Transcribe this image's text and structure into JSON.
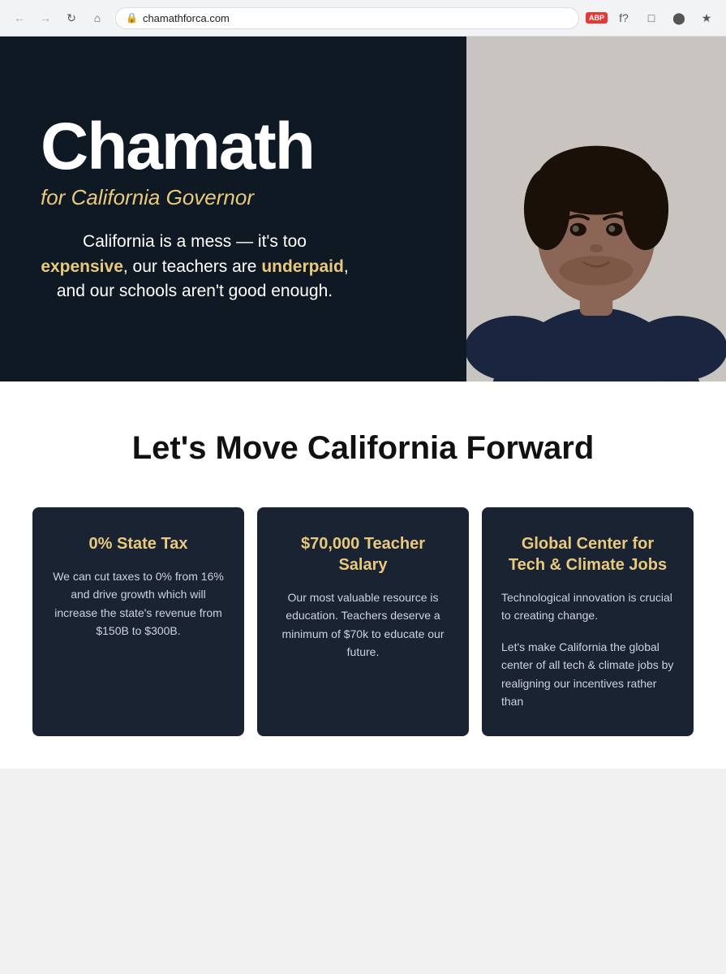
{
  "browser": {
    "url": "chamathforca.com",
    "back_label": "←",
    "forward_label": "→",
    "refresh_label": "↻",
    "home_label": "⌂",
    "abp_label": "ABP",
    "extensions": [
      "f?",
      "◻",
      "●",
      "⚙"
    ]
  },
  "hero": {
    "title": "Chamath",
    "subtitle": "for California Governor",
    "description_plain": "California is a mess — it's too ",
    "description_expensive": "expensive",
    "description_mid": ", our teachers are ",
    "description_underpaid": "underpaid",
    "description_end": ", and our schools aren't good enough."
  },
  "main": {
    "section_title": "Let's Move California Forward",
    "cards": [
      {
        "title": "0% State Tax",
        "body": "We can cut taxes to 0% from 16% and drive growth which will increase the state's revenue from $150B to $300B."
      },
      {
        "title": "$70,000 Teacher Salary",
        "body": "Our most valuable resource is education. Teachers deserve a minimum of $70k to educate our future."
      },
      {
        "title": "Global Center for Tech & Climate Jobs",
        "body_line1": "Technological innovation is crucial to creating change.",
        "body_line2": "Let's make California the global center of all tech & climate jobs by realigning our incentives rather than"
      }
    ]
  }
}
